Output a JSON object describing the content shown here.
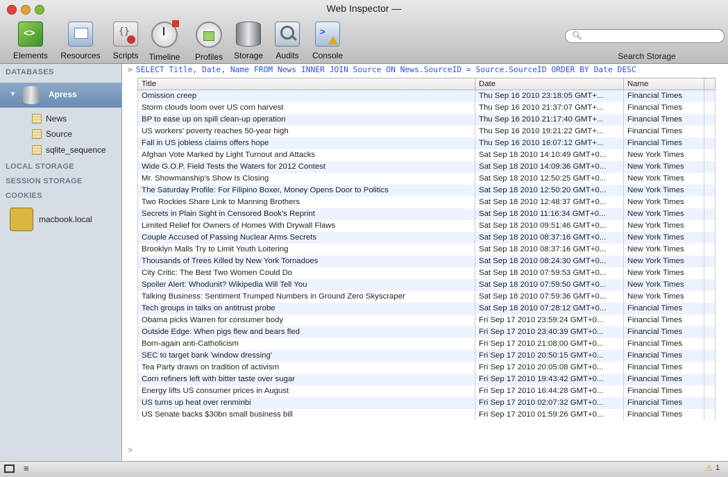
{
  "window": {
    "title": "Web Inspector —"
  },
  "toolbar": {
    "items": [
      {
        "label": "Elements"
      },
      {
        "label": "Resources"
      },
      {
        "label": "Scripts"
      },
      {
        "label": "Timeline"
      },
      {
        "label": "Profiles"
      },
      {
        "label": "Storage"
      },
      {
        "label": "Audits"
      },
      {
        "label": "Console"
      }
    ],
    "search_label": "Search Storage",
    "search_placeholder": ""
  },
  "sidebar": {
    "sections": {
      "databases": "DATABASES",
      "local_storage": "LOCAL STORAGE",
      "session_storage": "SESSION STORAGE",
      "cookies": "COOKIES"
    },
    "database": "Apress",
    "tables": [
      "News",
      "Source",
      "sqlite_sequence"
    ],
    "cookie_host": "macbook.local"
  },
  "query": {
    "prompt": ">",
    "text": "SELECT Title, Date, Name FROM News INNER JOIN Source ON News.SourceID = Source.SourceID ORDER BY Date DESC"
  },
  "results": {
    "headers": [
      "Title",
      "Date",
      "Name"
    ],
    "rows": [
      [
        "Omission creep",
        "Thu Sep 16 2010 23:18:05 GMT+...",
        "Financial Times"
      ],
      [
        "Storm clouds loom over US corn harvest",
        "Thu Sep 16 2010 21:37:07 GMT+...",
        "Financial Times"
      ],
      [
        "BP to ease up on spill clean-up operation",
        "Thu Sep 16 2010 21:17:40 GMT+...",
        "Financial Times"
      ],
      [
        "US workers' poverty reaches 50-year high",
        "Thu Sep 16 2010 19:21:22 GMT+...",
        "Financial Times"
      ],
      [
        "Fall in US jobless claims offers hope",
        "Thu Sep 16 2010 16:07:12 GMT+...",
        "Financial Times"
      ],
      [
        "Afghan Vote Marked by Light Turnout and Attacks",
        "Sat Sep 18 2010 14:10:49 GMT+0...",
        "New York Times"
      ],
      [
        "Wide G.O.P. Field Tests the Waters for 2012 Contest",
        "Sat Sep 18 2010 14:09:36 GMT+0...",
        "New York Times"
      ],
      [
        "Mr. Showmanship's Show Is Closing",
        "Sat Sep 18 2010 12:50:25 GMT+0...",
        "New York Times"
      ],
      [
        "The Saturday Profile: For Filipino Boxer, Money Opens Door to Politics",
        "Sat Sep 18 2010 12:50:20 GMT+0...",
        "New York Times"
      ],
      [
        "Two Rockies Share Link to Manning Brothers",
        "Sat Sep 18 2010 12:48:37 GMT+0...",
        "New York Times"
      ],
      [
        "Secrets in Plain Sight in Censored Book's Reprint",
        "Sat Sep 18 2010 11:16:34 GMT+0...",
        "New York Times"
      ],
      [
        "Limited Relief for Owners of Homes With Drywall Flaws",
        "Sat Sep 18 2010 09:51:46 GMT+0...",
        "New York Times"
      ],
      [
        "Couple Accused of Passing Nuclear Arms Secrets",
        "Sat Sep 18 2010 08:37:16 GMT+0...",
        "New York Times"
      ],
      [
        "Brooklyn Malls Try to Limit Youth Loitering",
        "Sat Sep 18 2010 08:37:16 GMT+0...",
        "New York Times"
      ],
      [
        "Thousands of Trees Killed by New York Tornadoes",
        "Sat Sep 18 2010 08:24:30 GMT+0...",
        "New York Times"
      ],
      [
        "City Critic: The Best Two Women Could Do",
        "Sat Sep 18 2010 07:59:53 GMT+0...",
        "New York Times"
      ],
      [
        "Spoiler Alert: Whodunit? Wikipedia Will Tell You",
        "Sat Sep 18 2010 07:59:50 GMT+0...",
        "New York Times"
      ],
      [
        "Talking Business: Sentiment Trumped Numbers in Ground Zero Skyscraper",
        "Sat Sep 18 2010 07:59:36 GMT+0...",
        "New York Times"
      ],
      [
        "Tech groups in talks on antitrust probe",
        "Sat Sep 18 2010 07:28:12 GMT+0...",
        "Financial Times"
      ],
      [
        "Obama picks Warren for consumer body",
        "Fri Sep 17 2010 23:59:24 GMT+0...",
        "Financial Times"
      ],
      [
        "Outside Edge: When pigs flew and bears fled",
        "Fri Sep 17 2010 23:40:39 GMT+0...",
        "Financial Times"
      ],
      [
        "Born-again anti-Catholicism",
        "Fri Sep 17 2010 21:08:00 GMT+0...",
        "Financial Times"
      ],
      [
        "SEC to target bank 'window dressing'",
        "Fri Sep 17 2010 20:50:15 GMT+0...",
        "Financial Times"
      ],
      [
        "Tea Party draws on tradition of activism",
        "Fri Sep 17 2010 20:05:08 GMT+0...",
        "Financial Times"
      ],
      [
        "Corn refiners left with bitter taste over sugar",
        "Fri Sep 17 2010 19:43:42 GMT+0...",
        "Financial Times"
      ],
      [
        "Energy lifts US consumer prices in August",
        "Fri Sep 17 2010 16:44:28 GMT+0...",
        "Financial Times"
      ],
      [
        "US turns up heat over renminbi",
        "Fri Sep 17 2010 02:07:32 GMT+0...",
        "Financial Times"
      ],
      [
        "US Senate backs $30bn small business bill",
        "Fri Sep 17 2010 01:59:26 GMT+0...",
        "Financial Times"
      ]
    ]
  },
  "console": {
    "prompt": ">"
  },
  "statusbar": {
    "warning_count": "1"
  },
  "colors": {
    "query_text": "#2a55d8",
    "row_stripe": "#edf3fe",
    "selection": "#7a99bf",
    "sidebar_bg": "#d6dde5"
  }
}
